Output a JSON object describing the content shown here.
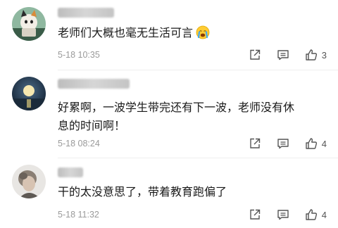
{
  "comments": [
    {
      "avatar": "cat-avatar",
      "username": "",
      "text": "老师们大概也毫无生活可言",
      "emoji": "crying-face-emoji",
      "date": "5-18 10:35",
      "likes": "3"
    },
    {
      "avatar": "moon-avatar",
      "username": "",
      "text_line1": "好累啊，一波学生带完还有下一波，老师没有休",
      "text_line2": "息的时间啊！",
      "date": "5-18 08:24",
      "likes": "4"
    },
    {
      "avatar": "person-avatar",
      "username": "",
      "text": "干的太没意思了，带着教育跑偏了",
      "date": "5-18 11:32",
      "likes": "4"
    }
  ],
  "icons": {
    "share": "share-icon",
    "reply": "comment-icon",
    "like": "thumbs-up-icon"
  }
}
